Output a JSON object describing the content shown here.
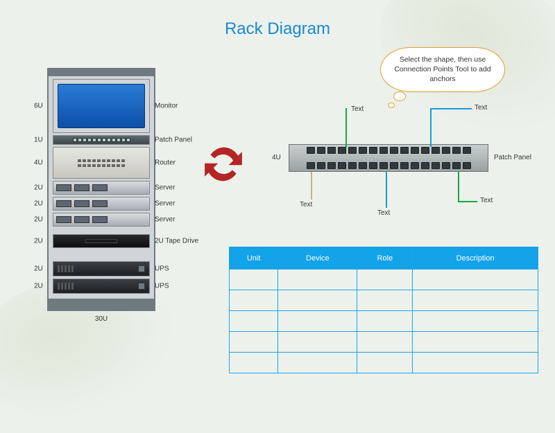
{
  "title": "Rack Diagram",
  "callout": "Select the shape, then use Connection Points Tool to add anchors",
  "rack": {
    "total_label": "30U",
    "items": [
      {
        "u": "6U",
        "label": "Monitor"
      },
      {
        "u": "1U",
        "label": "Patch Panel"
      },
      {
        "u": "4U",
        "label": "Router"
      },
      {
        "u": "2U",
        "label": "Server"
      },
      {
        "u": "2U",
        "label": "Server"
      },
      {
        "u": "2U",
        "label": "Server"
      },
      {
        "u": "2U",
        "label": "2U Tape Drive"
      },
      {
        "u": "2U",
        "label": "UPS"
      },
      {
        "u": "2U",
        "label": "UPS"
      }
    ]
  },
  "detail": {
    "u": "4U",
    "label": "Patch Panel",
    "wires": [
      {
        "color": "green",
        "label": "Text"
      },
      {
        "color": "blue",
        "label": "Text"
      },
      {
        "color": "tan",
        "label": "Text"
      },
      {
        "color": "blue",
        "label": "Text"
      },
      {
        "color": "green",
        "label": "Text"
      }
    ]
  },
  "sync_icon": "refresh-icon",
  "table": {
    "headers": [
      "Unit",
      "Device",
      "Role",
      "Description"
    ],
    "rows": 5
  }
}
